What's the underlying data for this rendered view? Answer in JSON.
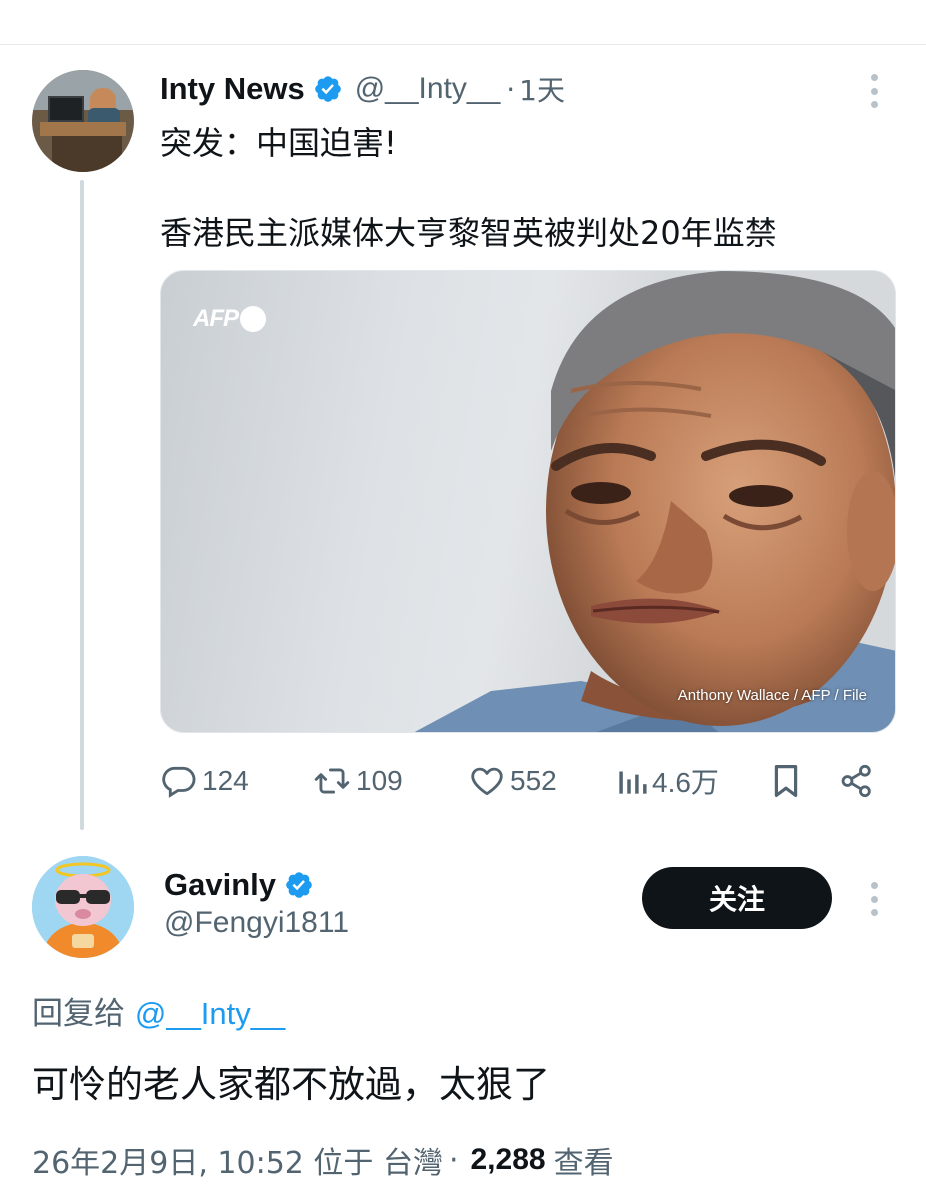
{
  "parent_tweet": {
    "name": "Inty News",
    "handle": "@__Inty__",
    "separator": "·",
    "time": "1天",
    "text_line1": "突发：中国迫害!",
    "text_line2": "香港民主派媒体大亨黎智英被判处20年监禁",
    "media": {
      "watermark": "AFP",
      "credit": "Anthony Wallace / AFP / File"
    },
    "actions": {
      "replies": "124",
      "retweets": "109",
      "likes": "552",
      "views": "4.6万"
    }
  },
  "reply_tweet": {
    "name": "Gavinly",
    "handle": "@Fengyi1811",
    "follow_label": "关注",
    "reply_to_prefix": "回复给",
    "reply_to_handle": "@__Inty__",
    "text": "可怜的老人家都不放過，太狠了",
    "timestamp": "26年2月9日, 10:52 位于 台灣",
    "meta_separator": "·",
    "view_count": "2,288",
    "view_label": "查看"
  },
  "colors": {
    "verified_badge": "#1d9bf0",
    "secondary_text": "#536471",
    "primary_text": "#0f1419",
    "mention": "#1d9bf0",
    "follow_button_bg": "#0f1419"
  },
  "icons": {
    "verified": "verified-badge-icon",
    "more": "more-options-icon",
    "reply": "reply-icon",
    "retweet": "retweet-icon",
    "like": "heart-icon",
    "views": "views-chart-icon",
    "bookmark": "bookmark-icon",
    "share": "share-icon"
  }
}
